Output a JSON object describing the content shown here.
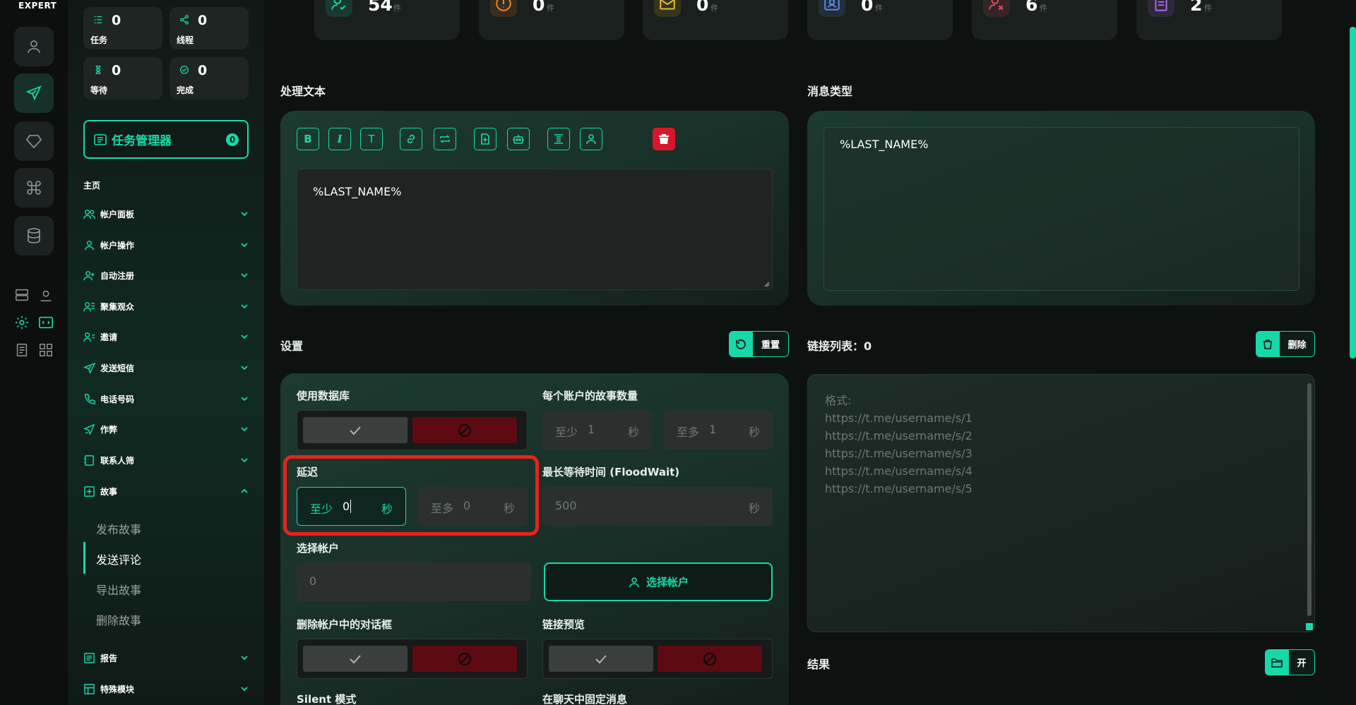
{
  "brand": "EXPERT",
  "sidebar_stats": [
    {
      "value": "0",
      "label": "任务",
      "icon": "list-icon"
    },
    {
      "value": "0",
      "label": "线程",
      "icon": "share-icon"
    },
    {
      "value": "0",
      "label": "等待",
      "icon": "hourglass-icon"
    },
    {
      "value": "0",
      "label": "完成",
      "icon": "check-circle-icon"
    }
  ],
  "task_manager": {
    "label": "任务管理器",
    "badge": "0"
  },
  "section_title": "主页",
  "nav": [
    {
      "label": "帐户面板",
      "icon": "users-icon"
    },
    {
      "label": "帐户操作",
      "icon": "user-icon"
    },
    {
      "label": "自动注册",
      "icon": "user-plus-icon"
    },
    {
      "label": "聚集观众",
      "icon": "group-icon"
    },
    {
      "label": "邀请",
      "icon": "invite-icon"
    },
    {
      "label": "发送短信",
      "icon": "send-icon"
    },
    {
      "label": "电话号码",
      "icon": "phone-icon"
    },
    {
      "label": "作弊",
      "icon": "boost-icon"
    },
    {
      "label": "联系人筛",
      "icon": "contacts-icon"
    },
    {
      "label": "故事",
      "icon": "plus-square-icon"
    }
  ],
  "story_sub": [
    "发布故事",
    "发送评论",
    "导出故事",
    "删除故事"
  ],
  "nav_bottom": [
    {
      "label": "报告",
      "icon": "report-icon"
    },
    {
      "label": "特殊模块",
      "icon": "module-icon"
    }
  ],
  "top_cards": [
    {
      "value": "54",
      "unit": "件",
      "icon": "user-check-icon",
      "color": "#17d9a8"
    },
    {
      "value": "0",
      "unit": "件",
      "icon": "alert-icon",
      "color": "#f0862a"
    },
    {
      "value": "0",
      "unit": "件",
      "icon": "mail-icon",
      "color": "#e6c229"
    },
    {
      "value": "0",
      "unit": "件",
      "icon": "id-card-icon",
      "color": "#5b8df0"
    },
    {
      "value": "6",
      "unit": "件",
      "icon": "user-x-icon",
      "color": "#e84a5f"
    },
    {
      "value": "2",
      "unit": "件",
      "icon": "clipboard-icon",
      "color": "#a96ae8"
    }
  ],
  "process_text": {
    "label": "处理文本",
    "content": "%LAST_NAME%",
    "toolbar": [
      "B",
      "I",
      "T"
    ]
  },
  "message_type": {
    "label": "消息类型",
    "content": "%LAST_NAME%"
  },
  "settings": {
    "label": "设置",
    "reset": "重置",
    "use_db": "使用数据库",
    "stories_per_account": "每个账户的故事数量",
    "spa_min": {
      "pre": "至少",
      "value": "1",
      "suf": "秒"
    },
    "spa_max": {
      "pre": "至多",
      "value": "1",
      "suf": "秒"
    },
    "delay": "延迟",
    "delay_min": {
      "pre": "至少",
      "value": "0",
      "suf": "秒"
    },
    "delay_max": {
      "pre": "至多",
      "value": "0",
      "suf": "秒"
    },
    "floodwait": "最长等待时间 (FloodWait)",
    "floodwait_field": {
      "value": "500",
      "suf": "秒"
    },
    "select_accounts": "选择帐户",
    "select_accounts_value": "0",
    "select_accounts_btn": "选择帐户",
    "delete_dialogs": "删除帐户中的对话框",
    "link_preview": "链接预览",
    "silent": "Silent 模式",
    "pin": "在聊天中固定消息"
  },
  "links": {
    "label": "链接列表：0",
    "delete": "删除",
    "placeholder": [
      "格式:",
      "https://t.me/username/s/1",
      "https://t.me/username/s/2",
      "https://t.me/username/s/3",
      "https://t.me/username/s/4",
      "https://t.me/username/s/5"
    ]
  },
  "result": {
    "label": "结果",
    "open": "开"
  },
  "colors": {
    "accent": "#17d9a8",
    "danger": "#d9152c",
    "highlight": "#e8231c"
  }
}
